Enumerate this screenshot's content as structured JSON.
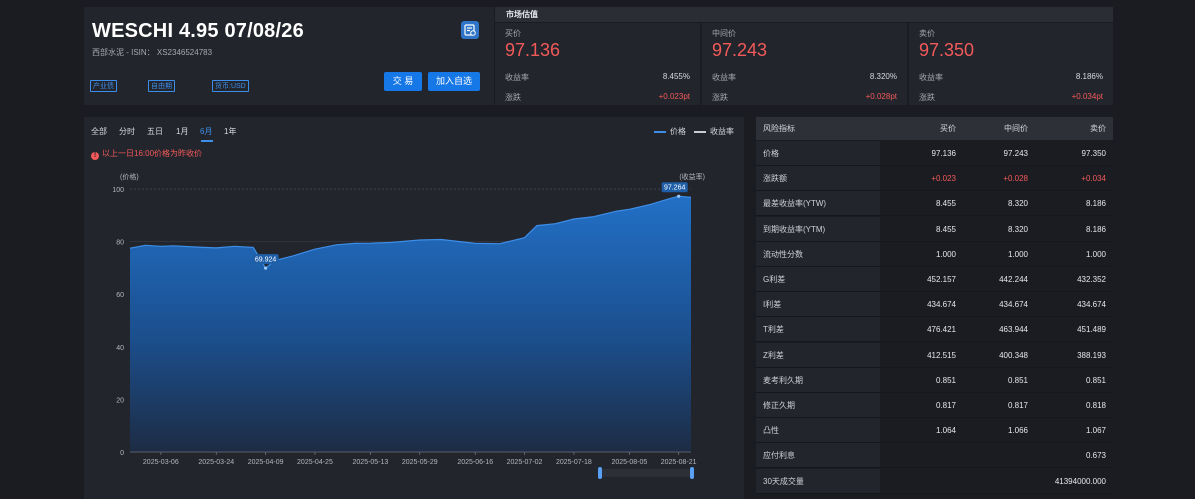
{
  "header": {
    "title": "WESCHI 4.95 07/08/26",
    "subtitle": "西部水泥 - ISIN： XS2346524783",
    "tags": [
      "产业债",
      "自由期",
      "货币:USD"
    ],
    "trade_button": "交 易",
    "watchlist_button": "加入自选",
    "icon": "calculator-icon"
  },
  "market": {
    "heading": "市场估值",
    "columns": [
      {
        "label": "买价",
        "price": "97.136",
        "yield_label": "收益率",
        "yield": "8.455%",
        "change_label": "涨跌",
        "change": "+0.023pt"
      },
      {
        "label": "中间价",
        "price": "97.243",
        "yield_label": "收益率",
        "yield": "8.320%",
        "change_label": "涨跌",
        "change": "+0.028pt"
      },
      {
        "label": "卖价",
        "price": "97.350",
        "yield_label": "收益率",
        "yield": "8.186%",
        "change_label": "涨跌",
        "change": "+0.034pt"
      }
    ]
  },
  "chart_controls": {
    "periods": [
      "全部",
      "分时",
      "五日",
      "1月",
      "6月",
      "1年"
    ],
    "active_period": "6月",
    "legend": [
      {
        "label": "价格",
        "color": "#3d8ee8"
      },
      {
        "label": "收益率",
        "color": "#c9ccd2"
      }
    ],
    "notice": "以上一日16:00价格为昨收价"
  },
  "chart_data": {
    "type": "area",
    "ylabel": "(价格)",
    "y2label": "(收益率)",
    "ylim": [
      0,
      100
    ],
    "yticks": [
      0,
      20,
      40,
      60,
      80,
      100
    ],
    "xticks": [
      "2025-03-06",
      "2025-03-24",
      "2025-04-09",
      "2025-04-25",
      "2025-05-13",
      "2025-05-29",
      "2025-06-16",
      "2025-07-02",
      "2025-07-18",
      "2025-08-05",
      "2025-08-21"
    ],
    "series": [
      {
        "name": "价格",
        "x": [
          "2025-02-24",
          "2025-03-01",
          "2025-03-06",
          "2025-03-10",
          "2025-03-18",
          "2025-03-24",
          "2025-03-30",
          "2025-04-05",
          "2025-04-09",
          "2025-04-12",
          "2025-04-18",
          "2025-04-25",
          "2025-05-02",
          "2025-05-08",
          "2025-05-13",
          "2025-05-20",
          "2025-05-29",
          "2025-06-05",
          "2025-06-16",
          "2025-06-24",
          "2025-07-02",
          "2025-07-06",
          "2025-07-12",
          "2025-07-18",
          "2025-07-24",
          "2025-08-01",
          "2025-08-05",
          "2025-08-12",
          "2025-08-18",
          "2025-08-21",
          "2025-08-25"
        ],
        "values": [
          77.5,
          78.6,
          78.2,
          78.4,
          77.9,
          77.6,
          78.2,
          77.8,
          69.9,
          72.8,
          74.6,
          77.1,
          78.8,
          79.3,
          79.4,
          79.7,
          80.6,
          80.8,
          79.3,
          79.2,
          81.5,
          86.1,
          86.8,
          88.6,
          89.4,
          91.6,
          92.3,
          94.2,
          96.3,
          97.264,
          96.8
        ]
      }
    ],
    "annotations": [
      {
        "label": "69.924",
        "x": "2025-04-09",
        "y": 69.924
      },
      {
        "label": "97.264",
        "x": "2025-08-21",
        "y": 97.264
      }
    ],
    "grid": true,
    "legend_placement": "top-right"
  },
  "risk": {
    "columns": [
      "风险指标",
      "买价",
      "中间价",
      "卖价"
    ],
    "rows": [
      {
        "label": "价格",
        "bid": "97.136",
        "mid": "97.243",
        "ask": "97.350",
        "red": false
      },
      {
        "label": "涨跌额",
        "bid": "+0.023",
        "mid": "+0.028",
        "ask": "+0.034",
        "red": true
      },
      {
        "label": "最差收益率(YTW)",
        "bid": "8.455",
        "mid": "8.320",
        "ask": "8.186",
        "red": false
      },
      {
        "label": "到期收益率(YTM)",
        "bid": "8.455",
        "mid": "8.320",
        "ask": "8.186",
        "red": false
      },
      {
        "label": "流动性分数",
        "bid": "1.000",
        "mid": "1.000",
        "ask": "1.000",
        "red": false
      },
      {
        "label": "G利差",
        "bid": "452.157",
        "mid": "442.244",
        "ask": "432.352",
        "red": false
      },
      {
        "label": "I利差",
        "bid": "434.674",
        "mid": "434.674",
        "ask": "434.674",
        "red": false
      },
      {
        "label": "T利差",
        "bid": "476.421",
        "mid": "463.944",
        "ask": "451.489",
        "red": false
      },
      {
        "label": "Z利差",
        "bid": "412.515",
        "mid": "400.348",
        "ask": "388.193",
        "red": false
      },
      {
        "label": "麦考利久期",
        "bid": "0.851",
        "mid": "0.851",
        "ask": "0.851",
        "red": false
      },
      {
        "label": "修正久期",
        "bid": "0.817",
        "mid": "0.817",
        "ask": "0.818",
        "red": false
      },
      {
        "label": "凸性",
        "bid": "1.064",
        "mid": "1.066",
        "ask": "1.067",
        "red": false
      },
      {
        "label": "应付利息",
        "bid": "",
        "mid": "",
        "ask": "0.673",
        "red": false
      },
      {
        "label": "30天成交量",
        "bid": "",
        "mid": "",
        "ask": "41394000.000",
        "red": false
      }
    ]
  }
}
